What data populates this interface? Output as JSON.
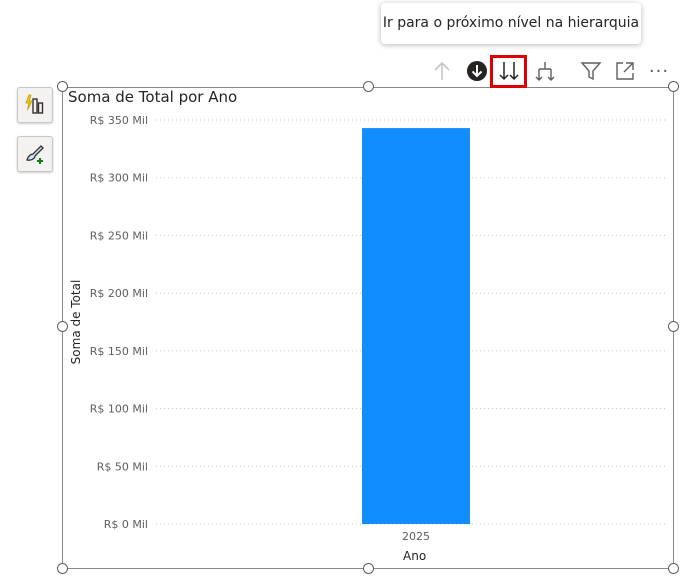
{
  "tooltip": {
    "text": "Ir para o próximo nível na hierarquia"
  },
  "toolbar": {
    "icons": [
      "arrow-up-icon",
      "drill-down-circle-icon",
      "double-arrow-down-icon",
      "expand-hierarchy-icon",
      "filter-icon",
      "focus-mode-icon",
      "more-options-icon"
    ],
    "more_label": "···"
  },
  "side_panel": {
    "icons": [
      "quick-insights-icon",
      "format-brush-icon"
    ]
  },
  "colors": {
    "bar": "#118dff",
    "grid": "#c8c6c4",
    "highlight": "#e00000"
  },
  "chart_data": {
    "type": "bar",
    "title": "Soma de Total por Ano",
    "xlabel": "Ano",
    "ylabel": "Soma de Total",
    "categories": [
      "2025"
    ],
    "values": [
      343000
    ],
    "ylim": [
      0,
      350000
    ],
    "yticks": [
      0,
      50000,
      100000,
      150000,
      200000,
      250000,
      300000,
      350000
    ],
    "ytick_labels": [
      "R$ 0 Mil",
      "R$ 50 Mil",
      "R$ 100 Mil",
      "R$ 150 Mil",
      "R$ 200 Mil",
      "R$ 250 Mil",
      "R$ 300 Mil",
      "R$ 350 Mil"
    ],
    "grid": true
  }
}
